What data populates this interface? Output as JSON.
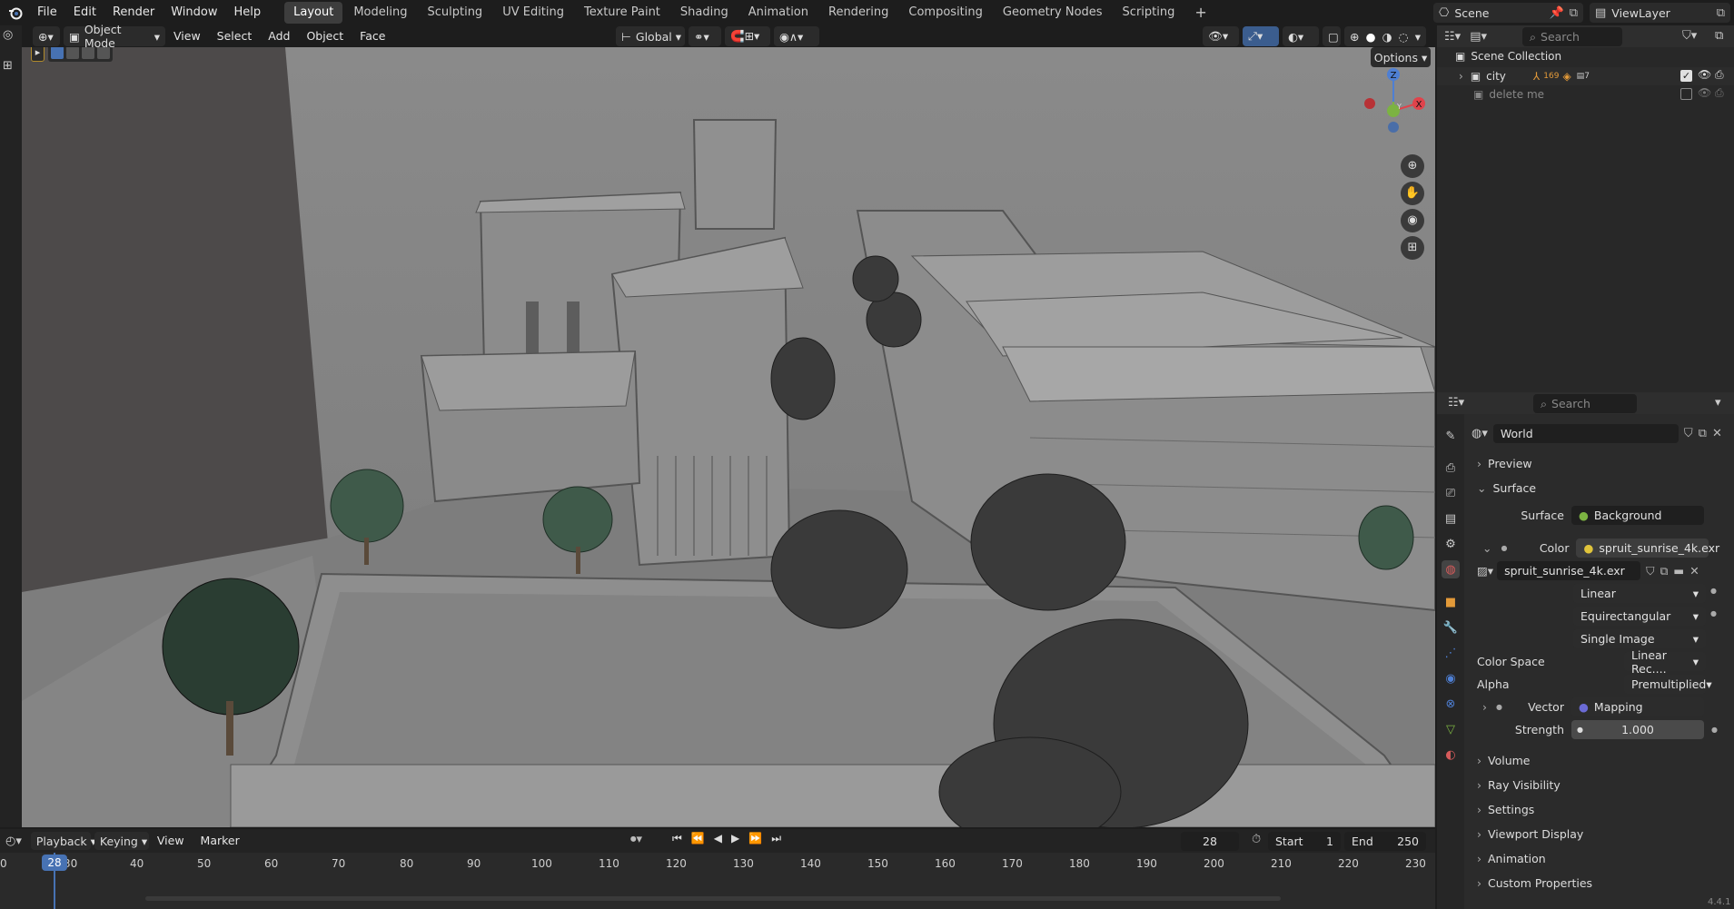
{
  "menu": [
    "File",
    "Edit",
    "Render",
    "Window",
    "Help"
  ],
  "workspaces": [
    "Layout",
    "Modeling",
    "Sculpting",
    "UV Editing",
    "Texture Paint",
    "Shading",
    "Animation",
    "Rendering",
    "Compositing",
    "Geometry Nodes",
    "Scripting"
  ],
  "active_workspace": "Layout",
  "add_tab": "+",
  "scene": {
    "label": "Scene",
    "view_layer": "ViewLayer"
  },
  "viewport_header": {
    "mode": "Object Mode",
    "view": "View",
    "select": "Select",
    "add": "Add",
    "object": "Object",
    "face": "Face",
    "transform": "Global",
    "options": "Options"
  },
  "outliner": {
    "search_placeholder": "Search",
    "root": "Scene Collection",
    "items": [
      {
        "name": "city",
        "badge1": "169",
        "badge2": "7"
      },
      {
        "name": "delete me"
      }
    ]
  },
  "properties": {
    "search_placeholder": "Search",
    "world_name": "World",
    "sections": {
      "preview": "Preview",
      "surface": "Surface",
      "volume": "Volume",
      "ray_visibility": "Ray Visibility",
      "settings": "Settings",
      "viewport_display": "Viewport Display",
      "animation": "Animation",
      "custom_properties": "Custom Properties"
    },
    "surface_label": "Surface",
    "surface_value": "Background",
    "color_label": "Color",
    "color_value": "spruit_sunrise_4k.exr",
    "image_name": "spruit_sunrise_4k.exr",
    "interpolation": "Linear",
    "projection": "Equirectangular",
    "source": "Single Image",
    "color_space_label": "Color Space",
    "color_space_value": "Linear Rec....",
    "alpha_label": "Alpha",
    "alpha_value": "Premultiplied",
    "vector_label": "Vector",
    "vector_value": "Mapping",
    "strength_label": "Strength",
    "strength_value": "1.000"
  },
  "timeline": {
    "playback": "Playback",
    "keying": "Keying",
    "view": "View",
    "marker": "Marker",
    "current_frame": "28",
    "start_label": "Start",
    "start": "1",
    "end_label": "End",
    "end": "250",
    "ticks": [
      "0",
      "30",
      "40",
      "50",
      "60",
      "70",
      "80",
      "90",
      "100",
      "110",
      "120",
      "130",
      "140",
      "150",
      "160",
      "170",
      "180",
      "190",
      "200",
      "210",
      "220",
      "230"
    ],
    "playhead": "28"
  },
  "version": "4.4.1",
  "colors": {
    "accent": "#4772b3",
    "bg": "#303030",
    "header": "#1d1d1d",
    "viewport": "#6f6f6f"
  }
}
